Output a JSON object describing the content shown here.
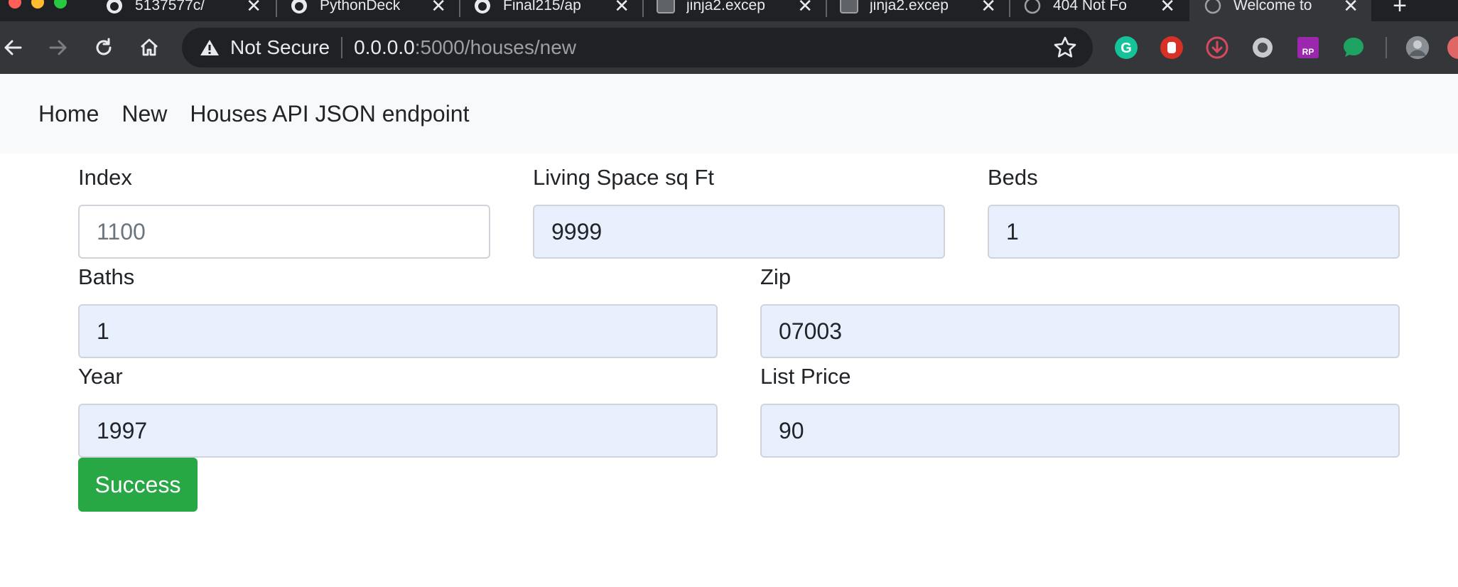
{
  "browser": {
    "tabs": [
      {
        "title": "5137577c/",
        "icon": "github-icon"
      },
      {
        "title": "PythonDeck",
        "icon": "github-icon"
      },
      {
        "title": "Final215/ap",
        "icon": "github-icon"
      },
      {
        "title": "jinja2.excep",
        "icon": "page-icon"
      },
      {
        "title": "jinja2.excep",
        "icon": "page-icon"
      },
      {
        "title": "404 Not Fo",
        "icon": "globe-icon"
      },
      {
        "title": "Welcome to",
        "icon": "globe-icon",
        "active": true
      }
    ],
    "address_bar": {
      "security_label": "Not Secure",
      "host": "0.0.0.0",
      "path": ":5000/houses/new"
    },
    "extensions": [
      "grammarly-icon",
      "stop-hand-icon",
      "download-icon",
      "circle-icon",
      "rp-icon",
      "chat-bubble-icon",
      "avatar",
      "extension-icon"
    ]
  },
  "nav": {
    "home": "Home",
    "new": "New",
    "api": "Houses API JSON endpoint"
  },
  "form": {
    "index": {
      "label": "Index",
      "placeholder": "1100"
    },
    "living_space": {
      "label": "Living Space sq Ft",
      "value": "9999"
    },
    "beds": {
      "label": "Beds",
      "value": "1"
    },
    "baths": {
      "label": "Baths",
      "value": "1"
    },
    "zip": {
      "label": "Zip",
      "value": "07003"
    },
    "year": {
      "label": "Year",
      "value": "1997"
    },
    "list_price": {
      "label": "List Price",
      "value": "90"
    },
    "submit_label": "Success"
  },
  "colors": {
    "success": "#28a745",
    "autofill_bg": "#e8f0fe",
    "navbar_bg": "#f8f9fa",
    "chrome_dark": "#202124",
    "chrome_toolbar": "#35363a"
  }
}
